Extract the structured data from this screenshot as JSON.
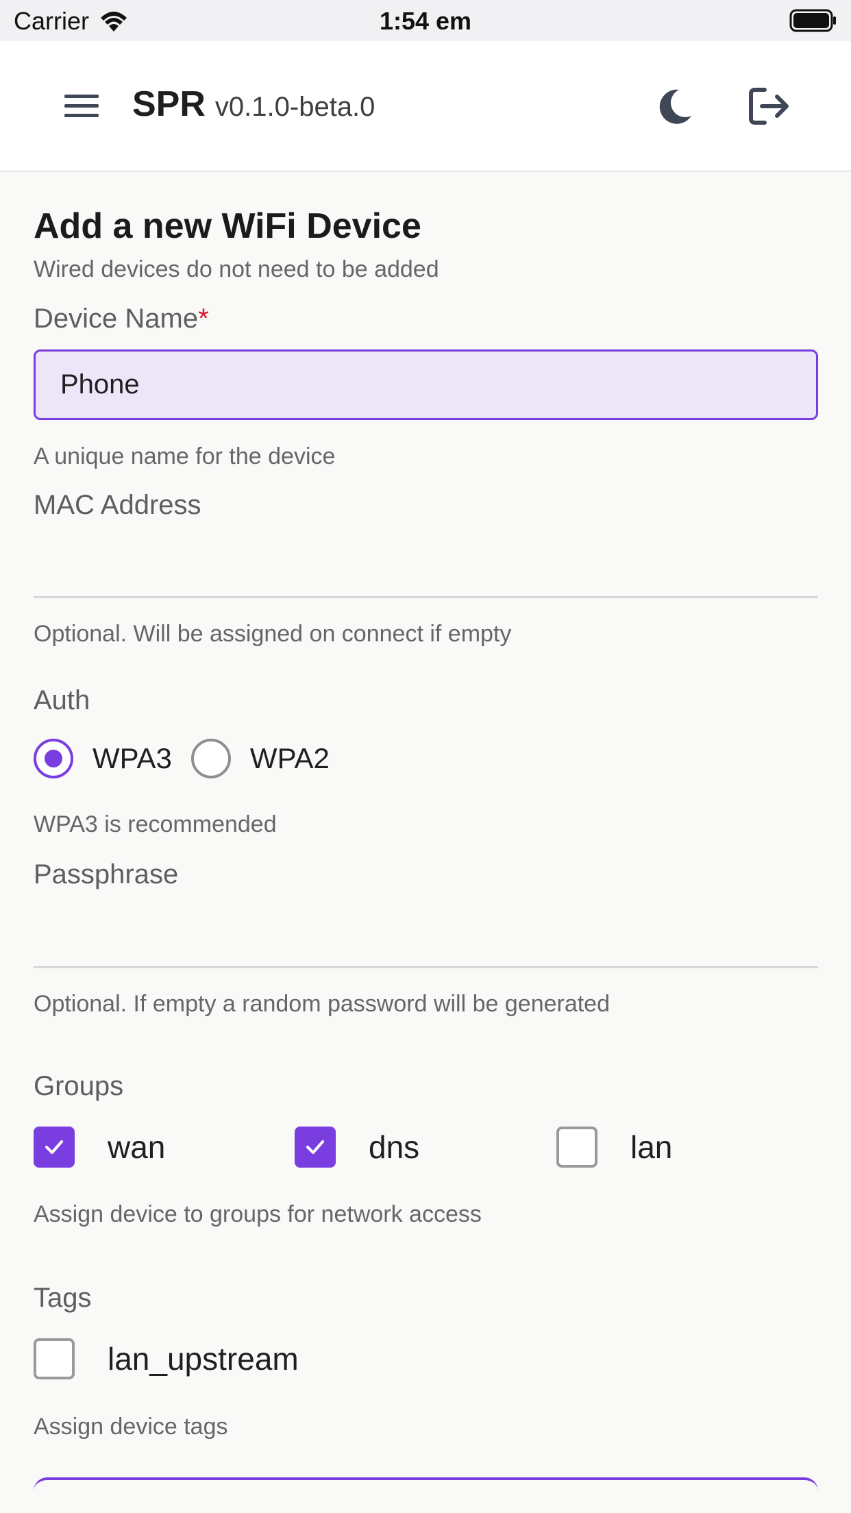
{
  "status_bar": {
    "carrier": "Carrier",
    "time": "1:54 em"
  },
  "header": {
    "brand": "SPR",
    "version": "v0.1.0-beta.0"
  },
  "form": {
    "title": "Add a new WiFi Device",
    "subtitle": "Wired devices do not need to be added",
    "device_name": {
      "label": "Device Name",
      "required_mark": "*",
      "value": "Phone",
      "helper": "A unique name for the device"
    },
    "mac": {
      "label": "MAC Address",
      "value": "",
      "helper": "Optional. Will be assigned on connect if empty"
    },
    "auth": {
      "label": "Auth",
      "options": [
        {
          "label": "WPA3",
          "selected": true
        },
        {
          "label": "WPA2",
          "selected": false
        }
      ],
      "helper": "WPA3 is recommended"
    },
    "passphrase": {
      "label": "Passphrase",
      "value": "",
      "helper": "Optional. If empty a random password will be generated"
    },
    "groups": {
      "label": "Groups",
      "items": [
        {
          "label": "wan",
          "checked": true
        },
        {
          "label": "dns",
          "checked": true
        },
        {
          "label": "lan",
          "checked": false
        }
      ],
      "helper": "Assign device to groups for network access"
    },
    "tags": {
      "label": "Tags",
      "items": [
        {
          "label": "lan_upstream",
          "checked": false
        }
      ],
      "helper": "Assign device tags"
    }
  },
  "colors": {
    "accent": "#7a3ee0",
    "required": "#d6182c",
    "input_bg": "#ede6f8"
  }
}
